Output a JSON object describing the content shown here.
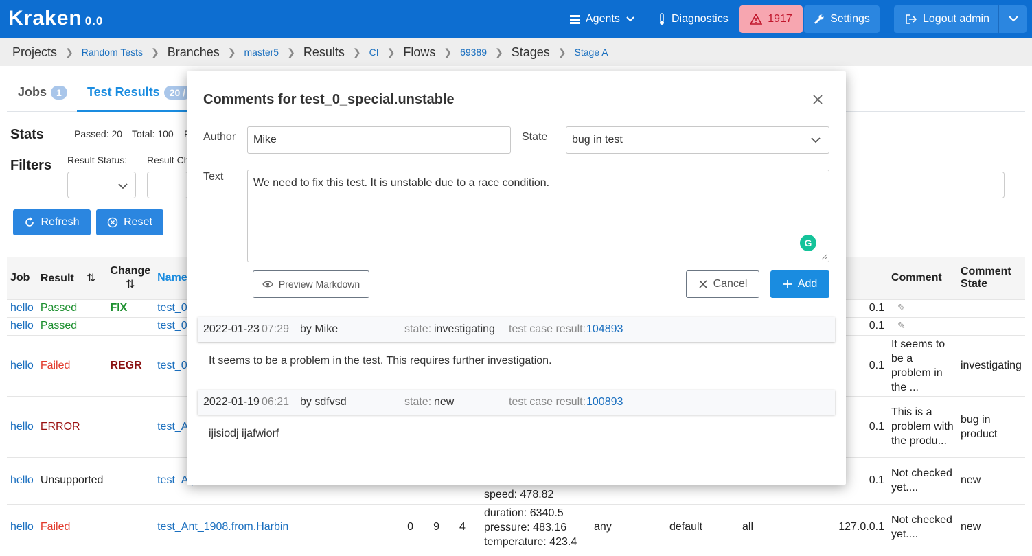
{
  "app": {
    "logo": "Kraken",
    "version": "0.0",
    "nav": {
      "agents": "Agents",
      "diagnostics": "Diagnostics",
      "alert_count": "1917",
      "settings": "Settings",
      "logout": "Logout admin"
    }
  },
  "breadcrumb": [
    {
      "label": "Projects",
      "link": false
    },
    {
      "label": "Random Tests",
      "link": true
    },
    {
      "label": "Branches",
      "link": false
    },
    {
      "label": "master5",
      "link": true
    },
    {
      "label": "Results",
      "link": false
    },
    {
      "label": "CI",
      "link": true
    },
    {
      "label": "Flows",
      "link": false
    },
    {
      "label": "69389",
      "link": true
    },
    {
      "label": "Stages",
      "link": false
    },
    {
      "label": "Stage A",
      "link": true
    }
  ],
  "page": {
    "tabs": [
      {
        "label": "Jobs",
        "count": "1"
      },
      {
        "label": "Test Results",
        "count": "20 /"
      }
    ],
    "stats": {
      "title": "Stats",
      "passed": "Passed: 20",
      "total": "Total: 100",
      "extra": "F"
    },
    "filters": {
      "title": "Filters",
      "result_status": "Result Status:",
      "result_change": "Result Ch",
      "colon": ":"
    },
    "refresh": "Refresh",
    "reset": "Reset",
    "table": {
      "headers": [
        "Job",
        "Result",
        "Change",
        "Name",
        "Comment",
        "Comment State"
      ],
      "rows": [
        {
          "job": "hello",
          "result": "Passed",
          "change": "FIX",
          "name": "test_0_",
          "ip": "0.1",
          "comment": "",
          "state": ""
        },
        {
          "job": "hello",
          "result": "Passed",
          "change": "",
          "name": "test_0_",
          "ip": "0.1",
          "comment": "",
          "state": ""
        },
        {
          "job": "hello",
          "result": "Failed",
          "change": "REGR",
          "name": "test_0_",
          "ip": "0.1",
          "comment": "It seems to be a problem in the ...",
          "state": "investigating"
        },
        {
          "job": "hello",
          "result": "ERROR",
          "change": "",
          "name": "test_All",
          "ip": "0.1",
          "comment": "This is a problem with the produ...",
          "state": "bug in product"
        },
        {
          "job": "hello",
          "result": "Unsupported",
          "change": "",
          "name": "test_Alp",
          "ip": "0.1",
          "comment": "Not checked yet....",
          "state": "new",
          "speed": "speed: 478.82"
        },
        {
          "job": "hello",
          "result": "Failed",
          "change": "",
          "name": "test_Ant_1908.from.Harbin",
          "n1": "0",
          "n2": "9",
          "n3": "4",
          "values": [
            "duration: 6340.5",
            "pressure: 483.16",
            "temperature: 423.4"
          ],
          "any": "any",
          "def": "default",
          "all": "all",
          "ip": "127.0.0.1",
          "comment": "Not checked yet....",
          "state": "new"
        }
      ]
    }
  },
  "modal": {
    "title": "Comments for test_0_special.unstable",
    "author_label": "Author",
    "author_value": "Mike",
    "state_label": "State",
    "state_value": "bug in test",
    "text_label": "Text",
    "text_value": "We need to fix this test. It is unstable due to a race condition.",
    "preview": "Preview Markdown",
    "cancel": "Cancel",
    "add": "Add",
    "comments": [
      {
        "date": "2022-01-23",
        "time": "07:29",
        "by": "by Mike",
        "state_label": "state:",
        "state": "investigating",
        "tcr_label": "test case result:",
        "tcr": "104893",
        "body": "It seems to be a problem in the test. This requires further investigation."
      },
      {
        "date": "2022-01-19",
        "time": "06:21",
        "by": "by sdfvsd",
        "state_label": "state:",
        "state": "new",
        "tcr_label": "test case result:",
        "tcr": "100893",
        "body": "ijisiodj ijafwiorf"
      }
    ]
  }
}
